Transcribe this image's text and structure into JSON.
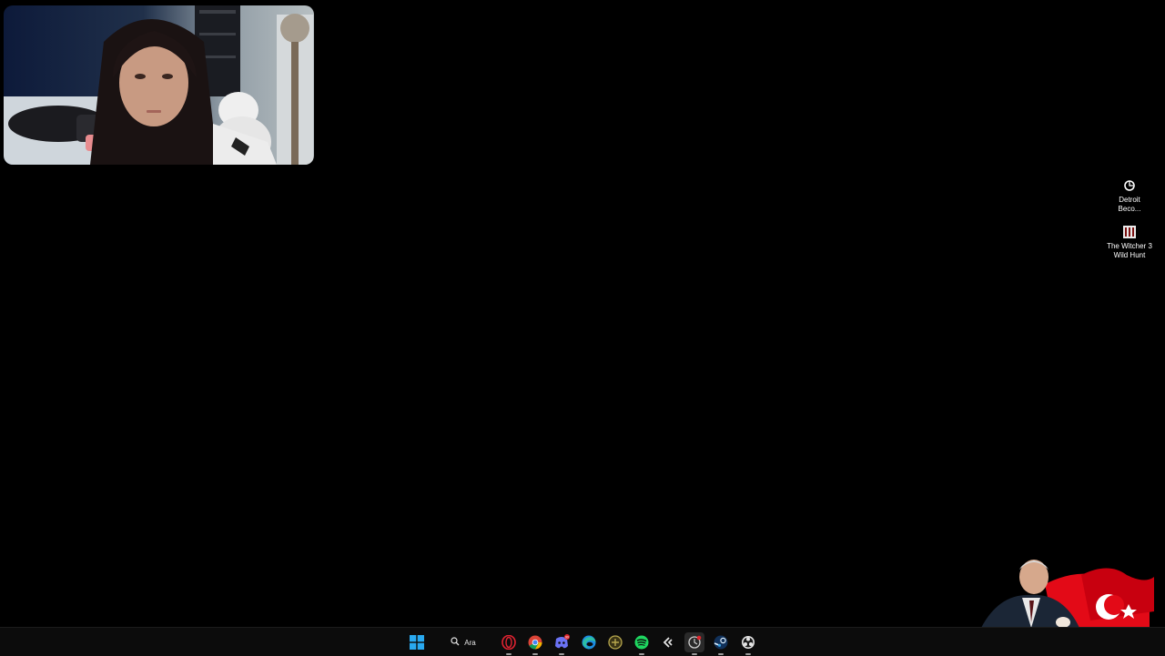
{
  "desktop": {
    "icons": [
      {
        "label_line1": "Detroit",
        "label_line2": "Beco...",
        "icon": "detroit-become-human-icon"
      },
      {
        "label_line1": "The Witcher 3",
        "label_line2": "Wild Hunt",
        "icon": "witcher-3-icon"
      }
    ]
  },
  "webcam": {
    "content": "streamer-webcam-feed"
  },
  "taskbar": {
    "search_label": "Ara",
    "icons": [
      {
        "name": "windows-start-icon",
        "color": "#29a9f0"
      },
      {
        "name": "search-icon"
      },
      {
        "name": "opera-gx-icon",
        "color": "#e02331"
      },
      {
        "name": "chrome-icon"
      },
      {
        "name": "discord-icon",
        "color": "#6b73f5",
        "badge": "99"
      },
      {
        "name": "edge-icon",
        "color": "#2dbfa4"
      },
      {
        "name": "game-app-icon",
        "color": "#b7a74d"
      },
      {
        "name": "spotify-icon",
        "color": "#1ed760"
      },
      {
        "name": "logitech-ghub-icon"
      },
      {
        "name": "recording-app-icon",
        "color": "#e0262d"
      },
      {
        "name": "steam-icon",
        "color": "#3aa0e0"
      },
      {
        "name": "obs-icon"
      }
    ]
  },
  "overlay": {
    "content": "flag-portrait-overlay",
    "flag_color": "#e30a17"
  }
}
